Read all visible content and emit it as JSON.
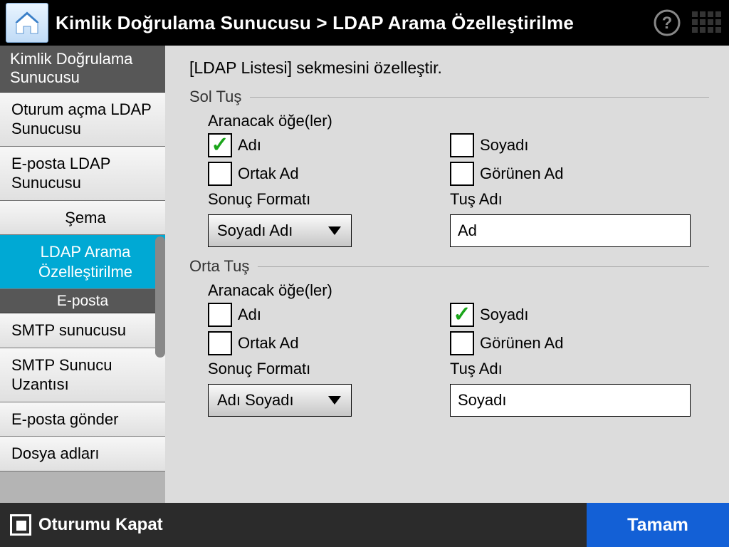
{
  "header": {
    "title": "Kimlik Doğrulama Sunucusu  >  LDAP Arama Özelleştirilme"
  },
  "sidebar": {
    "group1": "Kimlik Doğrulama Sunucusu",
    "items": [
      "Oturum açma LDAP Sunucusu",
      "E-posta LDAP Sunucusu",
      "Şema",
      "LDAP Arama Özelleştirilme"
    ],
    "group2": "E-posta",
    "items2": [
      "SMTP sunucusu",
      "SMTP Sunucu Uzantısı",
      "E-posta gönder",
      "Dosya adları"
    ]
  },
  "content": {
    "intro": "[LDAP Listesi] sekmesini özelleştir.",
    "left": {
      "title": "Sol Tuş",
      "items_label": "Aranacak öğe(ler)",
      "chk_first": "Adı",
      "chk_last": "Soyadı",
      "chk_common": "Ortak Ad",
      "chk_display": "Görünen Ad",
      "format_label": "Sonuç Formatı",
      "format_value": "Soyadı Adı",
      "keyname_label": "Tuş Adı",
      "keyname_value": "Ad"
    },
    "middle": {
      "title": "Orta Tuş",
      "items_label": "Aranacak öğe(ler)",
      "chk_first": "Adı",
      "chk_last": "Soyadı",
      "chk_common": "Ortak Ad",
      "chk_display": "Görünen Ad",
      "format_label": "Sonuç Formatı",
      "format_value": "Adı Soyadı",
      "keyname_label": "Tuş Adı",
      "keyname_value": "Soyadı"
    }
  },
  "footer": {
    "logout": "Oturumu Kapat",
    "ok": "Tamam"
  }
}
